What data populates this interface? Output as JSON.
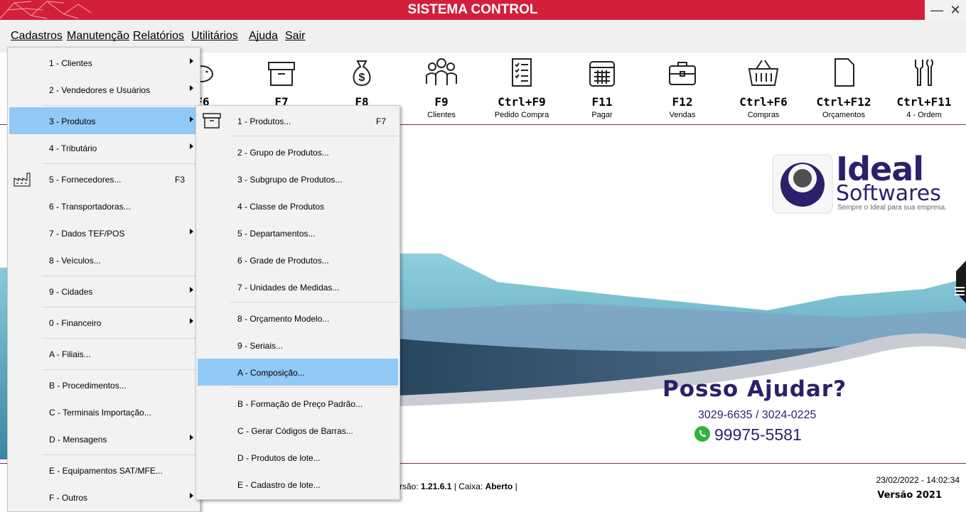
{
  "window": {
    "title": "SISTEMA CONTROL",
    "minimize": "—",
    "close": "✕"
  },
  "menubar": [
    "Cadastros",
    "Manutenção",
    "Relatórios",
    "Utilitários",
    "Ajuda",
    "Sair"
  ],
  "toolbar": [
    {
      "key": "F6",
      "label": "",
      "icon": "piggy-bank-icon"
    },
    {
      "key": "F7",
      "label": "",
      "icon": "box-icon"
    },
    {
      "key": "F8",
      "label": "",
      "icon": "money-bag-icon"
    },
    {
      "key": "F9",
      "label": "Clientes",
      "icon": "people-icon"
    },
    {
      "key": "Ctrl+F9",
      "label": "Pedido Compra",
      "icon": "checklist-icon"
    },
    {
      "key": "F11",
      "label": "Pagar",
      "icon": "calendar-icon"
    },
    {
      "key": "F12",
      "label": "Vendas",
      "icon": "briefcase-icon"
    },
    {
      "key": "Ctrl+F6",
      "label": "Compras",
      "icon": "basket-icon"
    },
    {
      "key": "Ctrl+F12",
      "label": "Orçamentos",
      "icon": "document-icon"
    },
    {
      "key": "Ctrl+F11",
      "label": "4 - Ordem",
      "icon": "tools-icon"
    }
  ],
  "cadastros_menu": [
    {
      "label": "1 - Clientes",
      "submenu": true
    },
    {
      "label": "2 - Vendedores e Usuários",
      "submenu": true
    },
    {
      "label": "3 - Produtos",
      "submenu": true,
      "selected": true
    },
    {
      "label": "4 - Tributário",
      "submenu": true
    },
    {
      "label": "5 - Fornecedores...",
      "shortcut": "F3",
      "icon": "factory-icon"
    },
    {
      "label": "6 - Transportadoras..."
    },
    {
      "label": "7 - Dados TEF/POS",
      "submenu": true
    },
    {
      "label": "8 - Veículos..."
    },
    {
      "label": "9 - Cidades",
      "submenu": true
    },
    {
      "label": "0 - Financeiro",
      "submenu": true
    },
    {
      "label": "A - Filiais..."
    },
    {
      "label": "B - Procedimentos..."
    },
    {
      "label": "C - Terminais Importação..."
    },
    {
      "label": "D - Mensagens",
      "submenu": true
    },
    {
      "label": "E - Equipamentos SAT/MFE..."
    },
    {
      "label": "F - Outros",
      "submenu": true
    }
  ],
  "produtos_menu": [
    {
      "label": "1 - Produtos...",
      "shortcut": "F7",
      "icon": "box-icon"
    },
    {
      "label": "2 - Grupo de Produtos..."
    },
    {
      "label": "3 - Subgrupo de Produtos..."
    },
    {
      "label": "4 - Classe de Produtos"
    },
    {
      "label": "5 - Departamentos..."
    },
    {
      "label": "6 - Grade de Produtos..."
    },
    {
      "label": "7 - Unidades de Medidas..."
    },
    {
      "label": "8 - Orçamento Modelo..."
    },
    {
      "label": "9 - Seriais..."
    },
    {
      "label": "A - Composição...",
      "selected": true
    },
    {
      "label": "B - Formação de Preço Padrão..."
    },
    {
      "label": "C - Gerar Códigos de Barras..."
    },
    {
      "label": "D - Produtos de lote..."
    },
    {
      "label": "E - Cadastro de lote..."
    }
  ],
  "logo": {
    "line1": "Ideal",
    "line2": "Softwares",
    "slogan": "Sempre o Ideal para sua empresa."
  },
  "banner": {
    "headline": "Posso Ajudar?",
    "phones": "3029-6635 / 3024-0225",
    "whatsapp": "99975-5581"
  },
  "status": {
    "version_prefix": "rsão:",
    "version": "1.21.6.1",
    "caixa_prefix": "| Caixa:",
    "caixa": "Aberto",
    "suffix": "|",
    "datetime": "23/02/2022 - 14:02:34",
    "versao_label": "Versão 2021"
  },
  "colors": {
    "titlebar": "#d21f3a",
    "highlight": "#91c9f7",
    "brand": "#2d1f6b"
  }
}
